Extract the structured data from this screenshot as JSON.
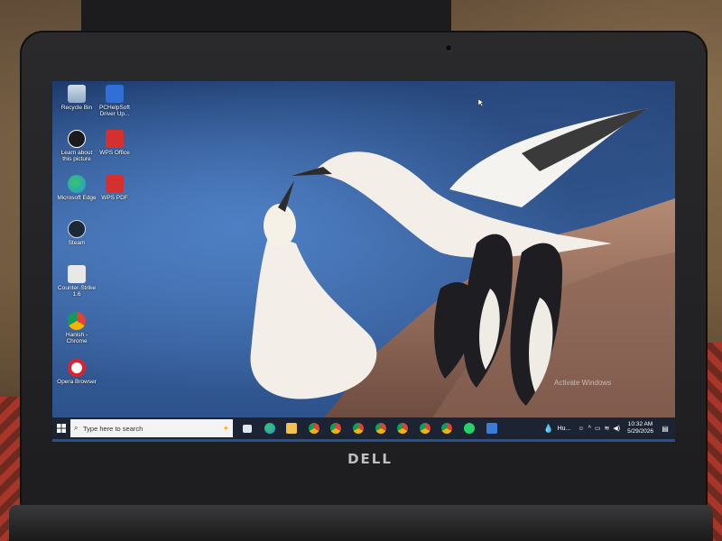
{
  "desktop": {
    "icons": [
      {
        "label": "Recycle Bin",
        "icon": "recycle-bin-icon",
        "color": "#9bb7d4"
      },
      {
        "label": "PCHelpSoft Driver Up...",
        "icon": "pchelpsoft-icon",
        "color": "#2f6fd6"
      },
      {
        "label": "Learn about this picture",
        "icon": "learn-picture-icon",
        "color": "#1b1b1b"
      },
      {
        "label": "WPS Office",
        "icon": "wps-office-icon",
        "color": "#d3302f"
      },
      {
        "label": "Microsoft Edge",
        "icon": "edge-icon",
        "color": "#1f9bd6"
      },
      {
        "label": "WPS PDF",
        "icon": "wps-pdf-icon",
        "color": "#d3302f"
      },
      {
        "label": "Steam",
        "icon": "steam-icon",
        "color": "#1b2838"
      },
      {
        "label": "Counter-Strike 1.6",
        "icon": "counter-strike-icon",
        "color": "#e8e8e8"
      },
      {
        "label": "Hanish - Chrome",
        "icon": "chrome-icon",
        "color": "#4caf50"
      },
      {
        "label": "Opera Browser",
        "icon": "opera-icon",
        "color": "#e0202c"
      }
    ]
  },
  "taskbar": {
    "search_placeholder": "Type here to search",
    "icons": [
      {
        "name": "task-view-icon",
        "color": "#dfe6ef"
      },
      {
        "name": "edge-taskbar-icon",
        "color": "#1f9bd6"
      },
      {
        "name": "file-explorer-icon",
        "color": "#f2c14e"
      },
      {
        "name": "chrome-taskbar-icon-1",
        "color": "#4caf50"
      },
      {
        "name": "chrome-taskbar-icon-2",
        "color": "#4caf50"
      },
      {
        "name": "chrome-taskbar-icon-3",
        "color": "#4caf50"
      },
      {
        "name": "chrome-taskbar-icon-4",
        "color": "#4caf50"
      },
      {
        "name": "chrome-taskbar-icon-5",
        "color": "#4caf50"
      },
      {
        "name": "chrome-taskbar-icon-6",
        "color": "#4caf50"
      },
      {
        "name": "chrome-taskbar-icon-7",
        "color": "#4caf50"
      },
      {
        "name": "whatsapp-icon",
        "color": "#25d366"
      },
      {
        "name": "calculator-icon",
        "color": "#3c7cd6"
      }
    ],
    "weather_label": "Hu...",
    "time": "10:32 AM",
    "date": "5/29/2026"
  },
  "watermark": {
    "text": "Activate Windows"
  },
  "device": {
    "brand": "DELL"
  },
  "colors": {
    "taskbar": "#1c2433",
    "accent": "#f0b429"
  }
}
